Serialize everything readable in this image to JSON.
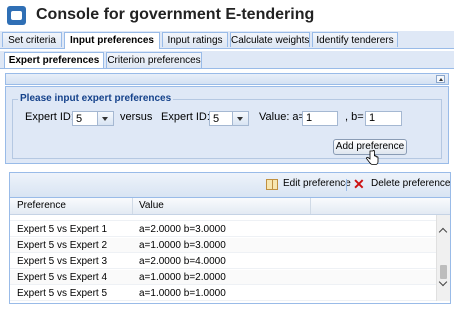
{
  "app": {
    "title": "Console for government E-tendering"
  },
  "tabs_main": [
    {
      "label": "Set criteria",
      "active": false
    },
    {
      "label": "Input preferences",
      "active": true
    },
    {
      "label": "Input ratings",
      "active": false
    },
    {
      "label": "Calculate weights",
      "active": false
    },
    {
      "label": "Identify tenderers",
      "active": false
    }
  ],
  "tabs_sub": [
    {
      "label": "Expert preferences",
      "active": true
    },
    {
      "label": "Criterion preferences",
      "active": false
    }
  ],
  "form": {
    "legend": "Please input expert preferences",
    "expert_id_label": "Expert ID:",
    "expert_id_1": "5",
    "versus_label": "versus",
    "expert_id_label_2": "Expert ID:",
    "expert_id_2": "5",
    "value_a_label": "Value: a=",
    "value_a": "1",
    "value_b_label": ", b=",
    "value_b": "1",
    "add_button": "Add preference"
  },
  "grid": {
    "toolbar": {
      "edit_label": "Edit preference",
      "delete_label": "Delete preference"
    },
    "columns": [
      "Preference",
      "Value"
    ],
    "rows": [
      {
        "preference": "Expert 5 vs Expert 1",
        "value": "a=2.0000 b=3.0000"
      },
      {
        "preference": "Expert 5 vs Expert 2",
        "value": "a=1.0000 b=3.0000"
      },
      {
        "preference": "Expert 5 vs Expert 3",
        "value": "a=2.0000 b=4.0000"
      },
      {
        "preference": "Expert 5 vs Expert 4",
        "value": "a=1.0000 b=2.0000"
      },
      {
        "preference": "Expert 5 vs Expert 5",
        "value": "a=1.0000 b=1.0000"
      }
    ]
  },
  "icons": {
    "app": "console-icon",
    "edit": "book-edit-icon",
    "delete": "red-x-icon",
    "cursor": "hand-pointer-icon"
  },
  "colors": {
    "accent": "#15428b",
    "panel": "#dfe8f6",
    "border": "#99bbe8",
    "delete": "#cc1111"
  }
}
